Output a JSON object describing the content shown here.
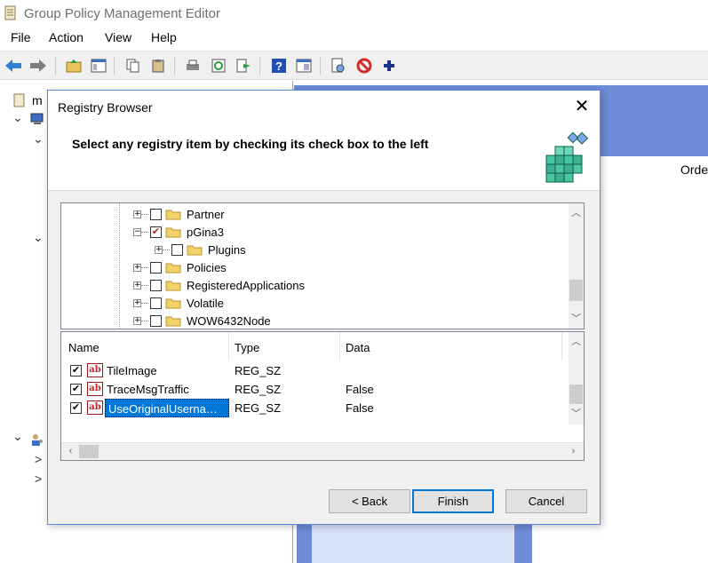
{
  "window": {
    "title": "Group Policy Management Editor"
  },
  "menu": [
    "File",
    "Action",
    "View",
    "Help"
  ],
  "left_pane": {
    "root_label": "m",
    "chevrons": [
      "⌄",
      "⌄",
      "⌄",
      "⌄",
      ">",
      ">"
    ]
  },
  "right_pane": {
    "order_header": "Orde"
  },
  "dialog": {
    "title": "Registry Browser",
    "close_glyph": "✕",
    "instruction": "Select any registry item by checking its check box to the left",
    "tree": [
      {
        "label": "Partner",
        "expander": "+",
        "checked": false
      },
      {
        "label": "pGina3",
        "expander": "−",
        "checked": true
      },
      {
        "label": "Plugins",
        "expander": "+",
        "checked": false
      },
      {
        "label": "Policies",
        "expander": "+",
        "checked": false
      },
      {
        "label": "RegisteredApplications",
        "expander": "+",
        "checked": false
      },
      {
        "label": "Volatile",
        "expander": "+",
        "checked": false
      },
      {
        "label": "WOW6432Node",
        "expander": "+",
        "checked": false
      }
    ],
    "list_columns": [
      "Name",
      "Type",
      "Data"
    ],
    "list_rows": [
      {
        "name": "TileImage",
        "type": "REG_SZ",
        "data": "",
        "checked": true,
        "icon": "ab"
      },
      {
        "name": "TraceMsgTraffic",
        "type": "REG_SZ",
        "data": "False",
        "checked": true,
        "icon": "ab"
      },
      {
        "name": "UseOriginalUserna…",
        "type": "REG_SZ",
        "data": "False",
        "checked": true,
        "icon": "ab"
      }
    ],
    "buttons": {
      "back": "< Back",
      "finish": "Finish",
      "cancel": "Cancel"
    }
  },
  "colors": {
    "accent_blue": "#0078d7",
    "pane_blue": "#6f8cd9",
    "check_red": "#b02020"
  }
}
